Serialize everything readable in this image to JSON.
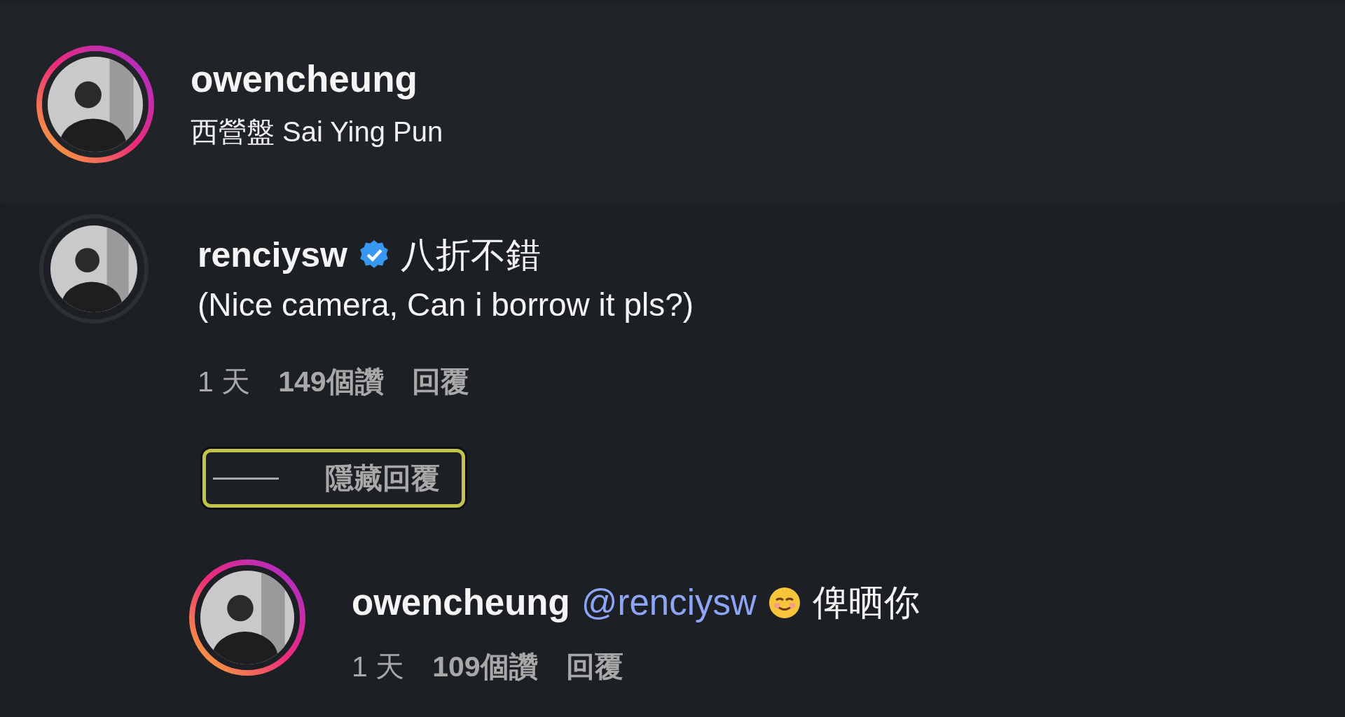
{
  "post_header": {
    "username": "owencheung",
    "location": "西營盤 Sai Ying Pun",
    "story_ring": true
  },
  "comment": {
    "username": "renciysw",
    "verified": true,
    "text": "八折不錯",
    "translation": "(Nice camera, Can i borrow it pls?)",
    "time": "1 天",
    "likes": "149個讚",
    "reply_label": "回覆",
    "story_ring": false
  },
  "hide_replies": {
    "label": "隱藏回覆",
    "highlighted": true
  },
  "reply": {
    "username": "owencheung",
    "mention": "@renciysw",
    "text": "俾晒你",
    "time": "1 天",
    "likes": "109個讚",
    "reply_label": "回覆",
    "story_ring": true
  }
}
